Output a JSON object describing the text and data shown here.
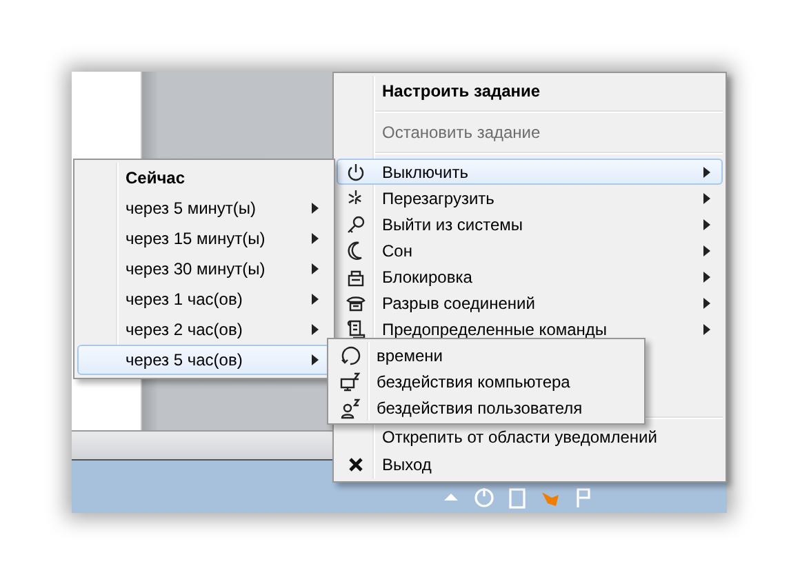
{
  "main_menu": {
    "items": [
      {
        "kind": "header",
        "label": "Настроить задание",
        "disabled": false,
        "selected": false,
        "submenu": false
      },
      {
        "kind": "separator"
      },
      {
        "kind": "item",
        "label": "Остановить задание",
        "disabled": true,
        "selected": false,
        "submenu": false
      },
      {
        "kind": "separator"
      },
      {
        "kind": "item",
        "label": "Выключить",
        "disabled": false,
        "selected": true,
        "submenu": true
      },
      {
        "kind": "item",
        "label": "Перезагрузить",
        "disabled": false,
        "selected": false,
        "submenu": true
      },
      {
        "kind": "item",
        "label": "Выйти из системы",
        "disabled": false,
        "selected": false,
        "submenu": true
      },
      {
        "kind": "item",
        "label": "Сон",
        "disabled": false,
        "selected": false,
        "submenu": true
      },
      {
        "kind": "item",
        "label": "Блокировка",
        "disabled": false,
        "selected": false,
        "submenu": true
      },
      {
        "kind": "item",
        "label": "Разрыв соединений",
        "disabled": false,
        "selected": false,
        "submenu": true
      },
      {
        "kind": "item",
        "label": "Предопределенные команды",
        "disabled": false,
        "selected": false,
        "submenu": true
      }
    ],
    "bottom_items": [
      {
        "kind": "separator"
      },
      {
        "kind": "item",
        "label": "Открепить от области уведомлений",
        "disabled": false,
        "selected": false,
        "submenu": false
      },
      {
        "kind": "item",
        "label": "Выход",
        "disabled": false,
        "selected": false,
        "submenu": false
      }
    ]
  },
  "time_submenu": {
    "items": [
      {
        "kind": "header",
        "label": "Сейчас",
        "selected": false,
        "submenu": false
      },
      {
        "kind": "item",
        "label": "через 5 минут(ы)",
        "selected": false,
        "submenu": true
      },
      {
        "kind": "item",
        "label": "через 15 минут(ы)",
        "selected": false,
        "submenu": true
      },
      {
        "kind": "item",
        "label": "через 30 минут(ы)",
        "selected": false,
        "submenu": true
      },
      {
        "kind": "item",
        "label": "через 1 час(ов)",
        "selected": false,
        "submenu": true
      },
      {
        "kind": "item",
        "label": "через 2 час(ов)",
        "selected": false,
        "submenu": true
      },
      {
        "kind": "item",
        "label": "через 5 час(ов)",
        "selected": true,
        "submenu": true
      }
    ]
  },
  "trigger_submenu": {
    "items": [
      {
        "kind": "item",
        "label": "времени",
        "selected": false,
        "submenu": false
      },
      {
        "kind": "item",
        "label": "бездействия компьютера",
        "selected": false,
        "submenu": false
      },
      {
        "kind": "item",
        "label": "бездействия пользователя",
        "selected": false,
        "submenu": false
      }
    ]
  }
}
